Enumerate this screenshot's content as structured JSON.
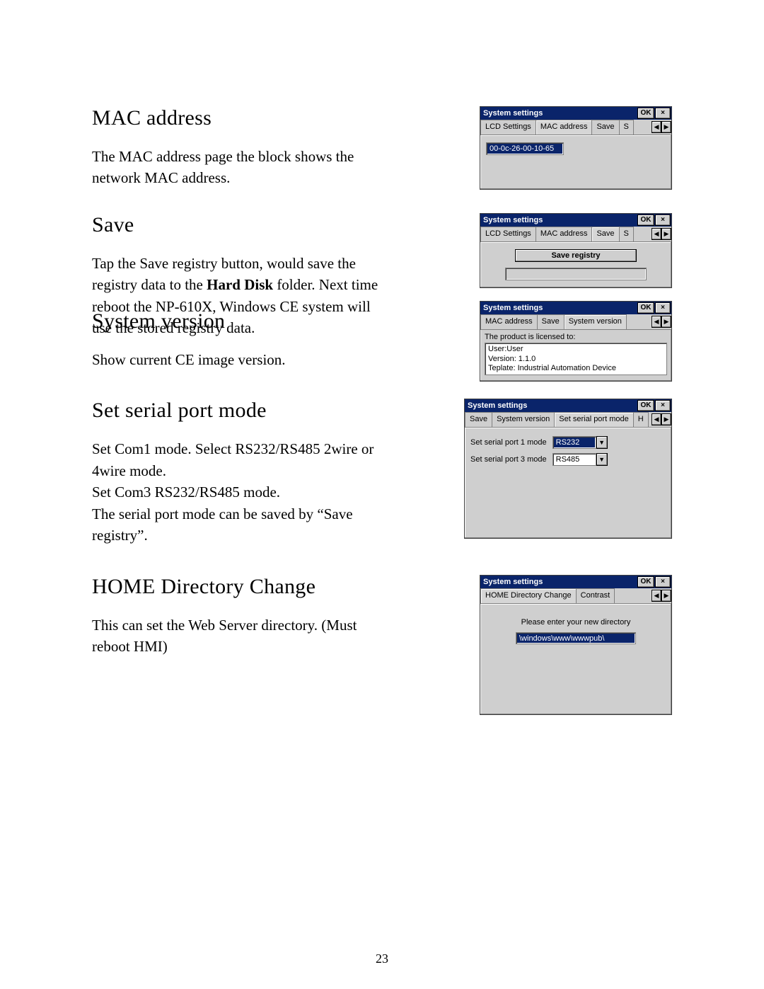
{
  "page_number": "23",
  "sections": {
    "mac": {
      "title": "MAC address",
      "body": "The MAC address page the block shows the network MAC address."
    },
    "save": {
      "title": "Save",
      "body_pre": "Tap the Save registry button, would save the registry data to the ",
      "body_bold": "Hard Disk",
      "body_post": " folder. Next time reboot the NP-610X, Windows CE system will use the stored registry data."
    },
    "sysver": {
      "title": "System version",
      "body": "Show current CE image version."
    },
    "serial": {
      "title": "Set serial port mode",
      "body": "Set Com1 mode. Select RS232/RS485 2wire or 4wire mode.\nSet Com3 RS232/RS485 mode.\nThe serial port mode can be saved by “Save registry”."
    },
    "home": {
      "title": "HOME Directory Change",
      "body": "This can set the Web Server directory. (Must reboot HMI)"
    }
  },
  "dialogs": {
    "common": {
      "title": "System settings",
      "ok": "OK",
      "close": "×",
      "left_arrow": "◀",
      "right_arrow": "▶",
      "down_arrow": "▼"
    },
    "mac": {
      "tabs": [
        "LCD Settings",
        "MAC address",
        "Save",
        "S"
      ],
      "value": "00-0c-26-00-10-65"
    },
    "save": {
      "tabs": [
        "LCD Settings",
        "MAC address",
        "Save",
        "S"
      ],
      "button": "Save registry"
    },
    "sysver": {
      "tabs": [
        "MAC address",
        "Save",
        "System version"
      ],
      "licensed_label": "The product is licensed to:",
      "lines": "User:User\nVersion: 1.1.0\nTeplate: Industrial Automation Device"
    },
    "serial": {
      "tabs": [
        "Save",
        "System version",
        "Set serial port mode",
        "H"
      ],
      "port1_label": "Set serial port 1 mode",
      "port1_value": "RS232",
      "port3_label": "Set serial port 3 mode",
      "port3_value": "RS485"
    },
    "home": {
      "tabs": [
        "HOME Directory Change",
        "Contrast"
      ],
      "msg": "Please enter your new directory",
      "value": "\\windows\\www\\wwwpub\\"
    }
  }
}
